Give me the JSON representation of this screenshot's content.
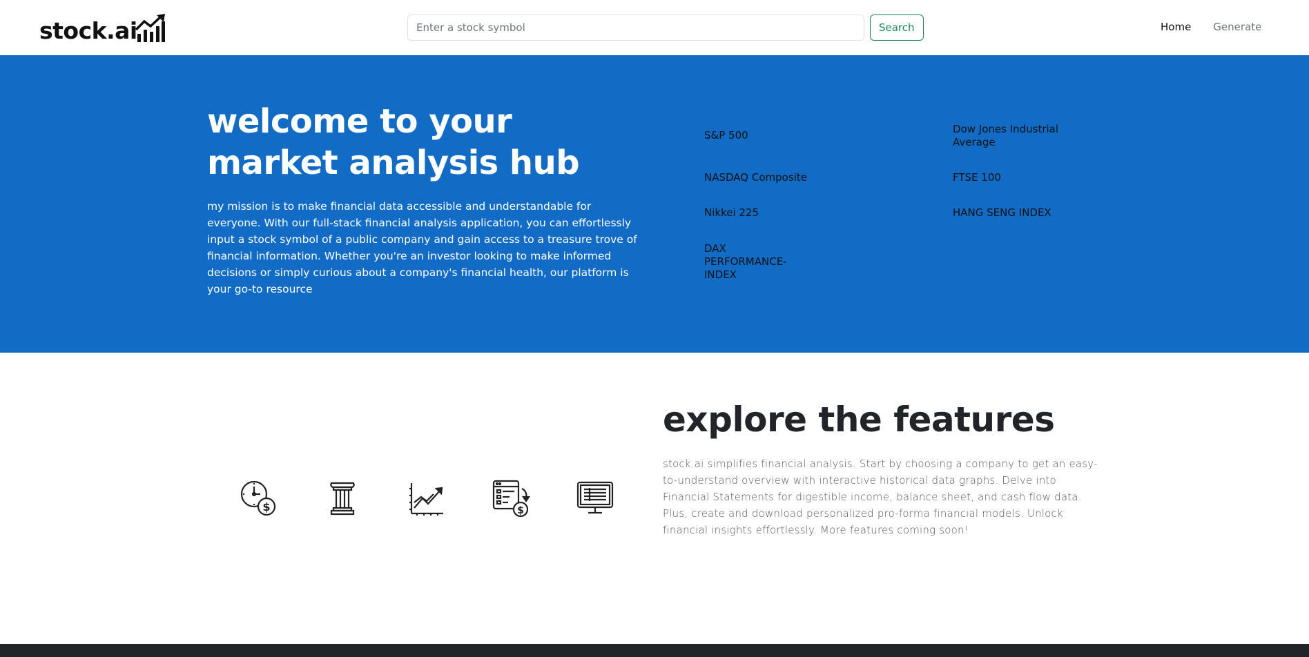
{
  "brand": {
    "name": "stock.ai",
    "logo_icon": "bar-chart-trend-up-icon"
  },
  "search": {
    "placeholder": "Enter a stock symbol",
    "value": "",
    "button_label": "Search",
    "button_color": "#198754"
  },
  "nav": {
    "home_label": "Home",
    "generate_label": "Generate"
  },
  "hero": {
    "background": "#126cc6",
    "title": "welcome to your market analysis hub",
    "description": "my mission is to make financial data accessible and understandable for everyone. With our full-stack financial analysis application, you can effortlessly input a stock symbol of a public company and gain access to a treasure trove of financial information. Whether you're an investor looking to make informed decisions or simply curious about a company's financial health, our platform is your go-to resource",
    "indices": [
      "S&P 500",
      "Dow Jones Industrial Average",
      "NASDAQ Composite",
      "FTSE 100",
      "Nikkei 225",
      "HANG SENG INDEX",
      "DAX PERFORMANCE-INDEX"
    ]
  },
  "features": {
    "title": "explore the features",
    "description": "stock.ai simplifies financial analysis. Start by choosing a company to get an easy-to-understand overview with interactive historical data graphs. Delve into Financial Statements for digestible income, balance sheet, and cash flow data. Plus, create and download personalized pro-forma financial models. Unlock financial insights effortlessly. More features coming soon!",
    "icons": [
      "clock-dollar-icon",
      "pillar-icon",
      "growth-chart-icon",
      "financial-statement-icon",
      "monitor-spreadsheet-icon"
    ]
  }
}
